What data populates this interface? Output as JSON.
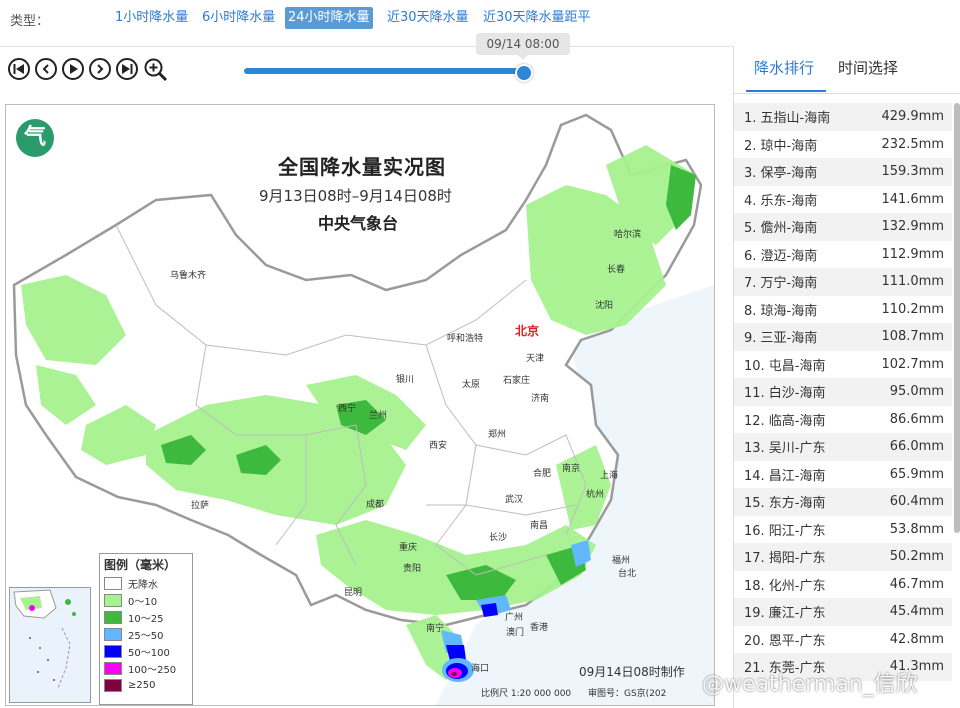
{
  "typebar": {
    "label": "类型：",
    "options": [
      {
        "label": "1小时降水量"
      },
      {
        "label": "6小时降水量"
      },
      {
        "label": "24小时降水量"
      },
      {
        "label": "近30天降水量"
      },
      {
        "label": "近30天降水量距平"
      }
    ],
    "selected": "24小时降水量"
  },
  "player": {
    "time_tooltip": "09/14 08:00",
    "progress": 1.0
  },
  "map": {
    "logo": "气",
    "title": "全国降水量实况图",
    "period": "9月13日08时–9月14日08时",
    "org": "中央气象台",
    "capital": "北京",
    "cities": [
      "乌鲁木齐",
      "哈尔滨",
      "长春",
      "沈阳",
      "呼和浩特",
      "天津",
      "石家庄",
      "太原",
      "银川",
      "济南",
      "西宁",
      "兰州",
      "郑州",
      "西安",
      "合肥",
      "南京",
      "上海",
      "拉萨",
      "成都",
      "武汉",
      "杭州",
      "重庆",
      "南昌",
      "长沙",
      "福州",
      "台北",
      "贵阳",
      "昆明",
      "广州",
      "南宁",
      "香港",
      "澳门",
      "海口"
    ],
    "legend": {
      "title": "图例（毫米）",
      "items": [
        {
          "label": "无降水",
          "color": "#ffffff"
        },
        {
          "label": "0～10",
          "color": "#a6f28f"
        },
        {
          "label": "10～25",
          "color": "#3dba3d"
        },
        {
          "label": "25～50",
          "color": "#61b8ff"
        },
        {
          "label": "50～100",
          "color": "#0000ff"
        },
        {
          "label": "100～250",
          "color": "#fa00fa"
        },
        {
          "label": "≥250",
          "color": "#800040"
        }
      ]
    },
    "footer_date": "09月14日08时制作",
    "scale": "比例尺 1:20 000 000",
    "review": "审图号：GS京(202"
  },
  "right_panel": {
    "tabs": [
      {
        "label": "降水排行"
      },
      {
        "label": "时间选择"
      }
    ],
    "rankings": [
      {
        "name": "1. 五指山-海南",
        "value": "429.9mm"
      },
      {
        "name": "2. 琼中-海南",
        "value": "232.5mm"
      },
      {
        "name": "3. 保亭-海南",
        "value": "159.3mm"
      },
      {
        "name": "4. 乐东-海南",
        "value": "141.6mm"
      },
      {
        "name": "5. 儋州-海南",
        "value": "132.9mm"
      },
      {
        "name": "6. 澄迈-海南",
        "value": "112.9mm"
      },
      {
        "name": "7. 万宁-海南",
        "value": "111.0mm"
      },
      {
        "name": "8. 琼海-海南",
        "value": "110.2mm"
      },
      {
        "name": "9. 三亚-海南",
        "value": "108.7mm"
      },
      {
        "name": "10. 屯昌-海南",
        "value": "102.7mm"
      },
      {
        "name": "11. 白沙-海南",
        "value": "95.0mm"
      },
      {
        "name": "12. 临高-海南",
        "value": "86.6mm"
      },
      {
        "name": "13. 吴川-广东",
        "value": "66.0mm"
      },
      {
        "name": "14. 昌江-海南",
        "value": "65.9mm"
      },
      {
        "name": "15. 东方-海南",
        "value": "60.4mm"
      },
      {
        "name": "16. 阳江-广东",
        "value": "53.8mm"
      },
      {
        "name": "17. 揭阳-广东",
        "value": "50.2mm"
      },
      {
        "name": "18. 化州-广东",
        "value": "46.7mm"
      },
      {
        "name": "19. 廉江-广东",
        "value": "45.4mm"
      },
      {
        "name": "20. 恩平-广东",
        "value": "42.8mm"
      },
      {
        "name": "21. 东莞-广东",
        "value": "41.3mm"
      }
    ]
  },
  "watermark": "@weatherman_信欣",
  "colors": {
    "accent": "#2c7bd6",
    "selected_bg": "#5b9bd5"
  }
}
